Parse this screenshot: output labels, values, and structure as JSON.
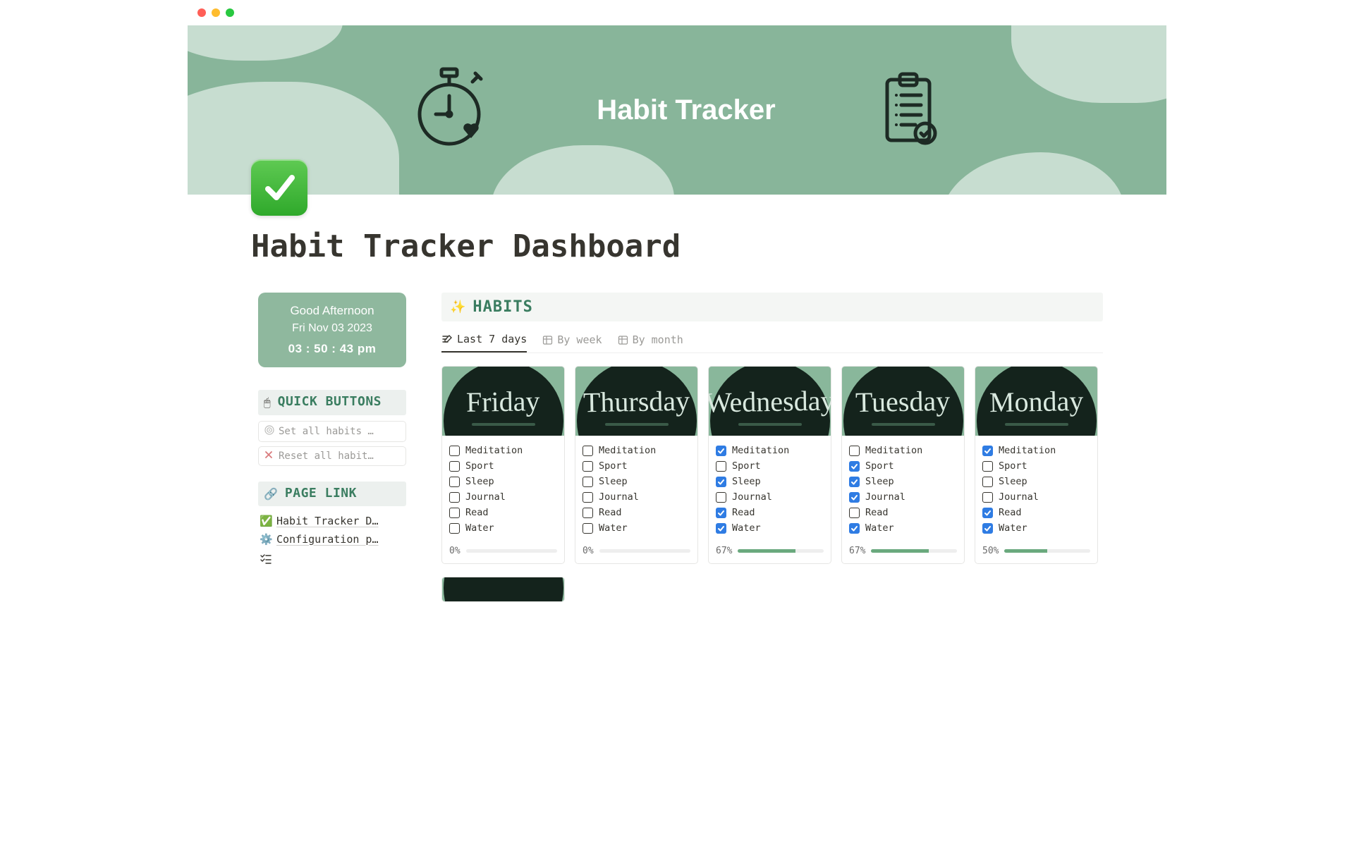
{
  "cover": {
    "title": "Habit Tracker"
  },
  "page": {
    "title": "Habit Tracker Dashboard"
  },
  "clock": {
    "greeting": "Good Afternoon",
    "date": "Fri Nov 03 2023",
    "time": "03  :  50  : 43 pm"
  },
  "quick_buttons": {
    "heading": "QUICK BUTTONS",
    "emoji": "🖱️",
    "set_all": "Set all habits …",
    "reset_all": "Reset all habit…"
  },
  "page_link": {
    "heading": "PAGE LINK",
    "emoji": "🔗",
    "links": [
      {
        "emoji": "✅",
        "label": "Habit Tracker D…"
      },
      {
        "emoji": "⚙️",
        "label": "Configuration p…"
      }
    ]
  },
  "habits_section": {
    "heading": "HABITS",
    "tabs": [
      {
        "label": "Last 7 days",
        "active": true,
        "icon": "list"
      },
      {
        "label": "By week",
        "active": false,
        "icon": "table"
      },
      {
        "label": "By month",
        "active": false,
        "icon": "table"
      }
    ]
  },
  "habits": [
    "Meditation",
    "Sport",
    "Sleep",
    "Journal",
    "Read",
    "Water"
  ],
  "days": [
    {
      "name": "Friday",
      "checked": [
        false,
        false,
        false,
        false,
        false,
        false
      ],
      "pct": "0%",
      "pct_val": 0
    },
    {
      "name": "Thursday",
      "checked": [
        false,
        false,
        false,
        false,
        false,
        false
      ],
      "pct": "0%",
      "pct_val": 0
    },
    {
      "name": "Wednesday",
      "checked": [
        true,
        false,
        true,
        false,
        true,
        true
      ],
      "pct": "67%",
      "pct_val": 67
    },
    {
      "name": "Tuesday",
      "checked": [
        false,
        true,
        true,
        true,
        false,
        true
      ],
      "pct": "67%",
      "pct_val": 67
    },
    {
      "name": "Monday",
      "checked": [
        true,
        false,
        false,
        false,
        true,
        true
      ],
      "pct": "50%",
      "pct_val": 50
    }
  ]
}
